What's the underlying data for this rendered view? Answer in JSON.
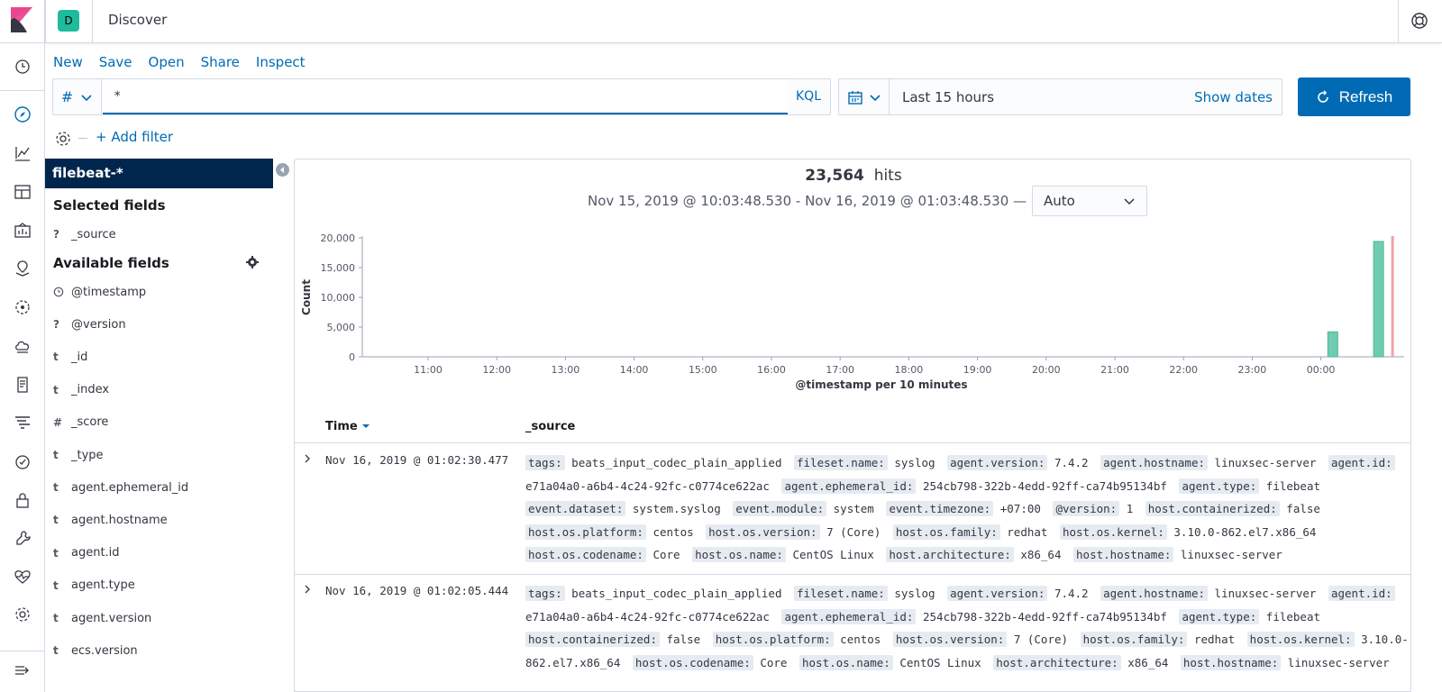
{
  "header": {
    "space_initial": "D",
    "app_title": "Discover"
  },
  "top_menu": [
    "New",
    "Save",
    "Open",
    "Share",
    "Inspect"
  ],
  "query": {
    "language_symbol": "#",
    "value": "*",
    "language_label": "KQL"
  },
  "time": {
    "range_label": "Last 15 hours",
    "show_dates_label": "Show dates",
    "refresh_label": "Refresh"
  },
  "filter": {
    "add_label": "+ Add filter"
  },
  "sidebar": {
    "index_pattern": "filebeat-*",
    "selected_heading": "Selected fields",
    "selected_fields": [
      {
        "type": "?",
        "name": "_source"
      }
    ],
    "available_heading": "Available fields",
    "available_fields": [
      {
        "type": "clock",
        "name": "@timestamp"
      },
      {
        "type": "?",
        "name": "@version"
      },
      {
        "type": "t",
        "name": "_id"
      },
      {
        "type": "t",
        "name": "_index"
      },
      {
        "type": "#",
        "name": "_score"
      },
      {
        "type": "t",
        "name": "_type"
      },
      {
        "type": "t",
        "name": "agent.ephemeral_id"
      },
      {
        "type": "t",
        "name": "agent.hostname"
      },
      {
        "type": "t",
        "name": "agent.id"
      },
      {
        "type": "t",
        "name": "agent.type"
      },
      {
        "type": "t",
        "name": "agent.version"
      },
      {
        "type": "t",
        "name": "ecs.version"
      }
    ]
  },
  "results": {
    "hits_count": "23,564",
    "hits_label": "hits",
    "time_range_text": "Nov 15, 2019 @ 10:03:48.530 - Nov 16, 2019 @ 01:03:48.530 —",
    "interval": "Auto"
  },
  "chart_data": {
    "type": "bar",
    "ylabel": "Count",
    "xlabel": "@timestamp per 10 minutes",
    "ylim": [
      0,
      20000
    ],
    "y_ticks": [
      "0",
      "5,000",
      "10,000",
      "15,000",
      "20,000"
    ],
    "x_ticks": [
      "11:00",
      "12:00",
      "13:00",
      "14:00",
      "15:00",
      "16:00",
      "17:00",
      "18:00",
      "19:00",
      "20:00",
      "21:00",
      "22:00",
      "23:00",
      "00:00"
    ],
    "bar_color": "#54b399",
    "series": [
      {
        "values": [
          {
            "x": "00:10",
            "y": 4200
          },
          {
            "x": "00:50",
            "y": 19400
          }
        ]
      }
    ],
    "now_marker": "01:03"
  },
  "table": {
    "col_time": "Time",
    "col_source": "_source",
    "rows": [
      {
        "time": "Nov 16, 2019 @ 01:02:30.477",
        "fields": [
          {
            "k": "tags:",
            "v": "beats_input_codec_plain_applied"
          },
          {
            "k": "fileset.name:",
            "v": "syslog"
          },
          {
            "k": "agent.version:",
            "v": "7.4.2"
          },
          {
            "k": "agent.hostname:",
            "v": "linuxsec-server"
          },
          {
            "k": "agent.id:",
            "v": "e71a04a0-a6b4-4c24-92fc-c0774ce622ac"
          },
          {
            "k": "agent.ephemeral_id:",
            "v": "254cb798-322b-4edd-92ff-ca74b95134bf"
          },
          {
            "k": "agent.type:",
            "v": "filebeat"
          },
          {
            "k": "event.dataset:",
            "v": "system.syslog"
          },
          {
            "k": "event.module:",
            "v": "system"
          },
          {
            "k": "event.timezone:",
            "v": "+07:00"
          },
          {
            "k": "@version:",
            "v": "1"
          },
          {
            "k": "host.containerized:",
            "v": "false"
          },
          {
            "k": "host.os.platform:",
            "v": "centos"
          },
          {
            "k": "host.os.version:",
            "v": "7 (Core)"
          },
          {
            "k": "host.os.family:",
            "v": "redhat"
          },
          {
            "k": "host.os.kernel:",
            "v": "3.10.0-862.el7.x86_64"
          },
          {
            "k": "host.os.codename:",
            "v": "Core"
          },
          {
            "k": "host.os.name:",
            "v": "CentOS Linux"
          },
          {
            "k": "host.architecture:",
            "v": "x86_64"
          },
          {
            "k": "host.hostname:",
            "v": "linuxsec-server"
          }
        ]
      },
      {
        "time": "Nov 16, 2019 @ 01:02:05.444",
        "fields": [
          {
            "k": "tags:",
            "v": "beats_input_codec_plain_applied"
          },
          {
            "k": "fileset.name:",
            "v": "syslog"
          },
          {
            "k": "agent.version:",
            "v": "7.4.2"
          },
          {
            "k": "agent.hostname:",
            "v": "linuxsec-server"
          },
          {
            "k": "agent.id:",
            "v": "e71a04a0-a6b4-4c24-92fc-c0774ce622ac"
          },
          {
            "k": "agent.ephemeral_id:",
            "v": "254cb798-322b-4edd-92ff-ca74b95134bf"
          },
          {
            "k": "agent.type:",
            "v": "filebeat"
          },
          {
            "k": "host.containerized:",
            "v": "false"
          },
          {
            "k": "host.os.platform:",
            "v": "centos"
          },
          {
            "k": "host.os.version:",
            "v": "7 (Core)"
          },
          {
            "k": "host.os.family:",
            "v": "redhat"
          },
          {
            "k": "host.os.kernel:",
            "v": "3.10.0-862.el7.x86_64"
          },
          {
            "k": "host.os.codename:",
            "v": "Core"
          },
          {
            "k": "host.os.name:",
            "v": "CentOS Linux"
          },
          {
            "k": "host.architecture:",
            "v": "x86_64"
          },
          {
            "k": "host.hostname:",
            "v": "linuxsec-server"
          }
        ]
      }
    ]
  },
  "colors": {
    "accent": "#006bb4",
    "index_bg": "#00264d",
    "bar": "#54b399"
  }
}
